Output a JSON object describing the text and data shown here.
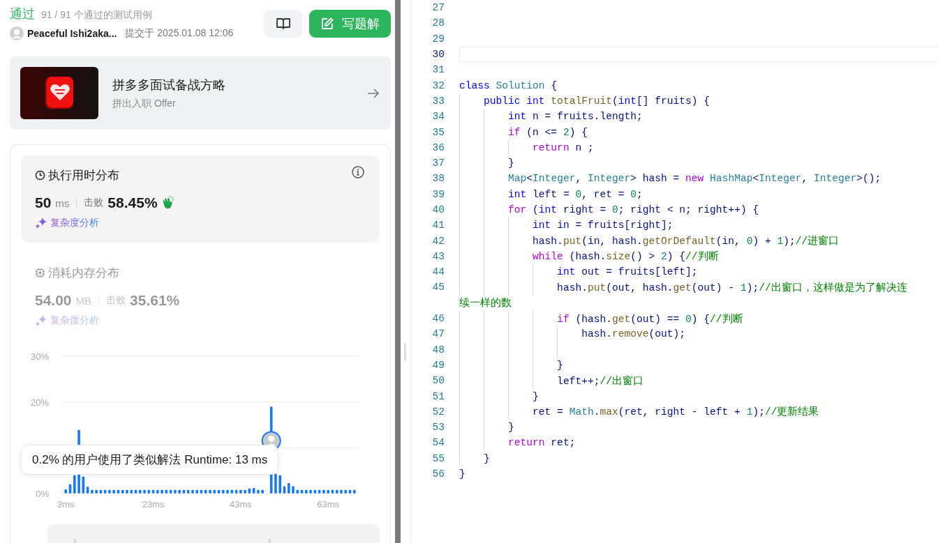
{
  "result": {
    "status": "通过",
    "cases": "91 / 91 个通过的测试用例"
  },
  "submitter": {
    "name": "Peaceful Ishi2aka...",
    "submitted": "提交于 2025.01.08 12:06"
  },
  "write_solution_button": {
    "label": "写题解"
  },
  "promo": {
    "kind": "picture",
    "title": "拼多多面试备战方略",
    "subtitle": "拼出入职 Offer"
  },
  "stats": [
    {
      "kind": "runtime",
      "title": "执行用时分布",
      "value": "50",
      "unit": "ms",
      "beats_label": "击败",
      "beats": "58.45%",
      "link": "复杂度分析",
      "selected": true
    },
    {
      "kind": "memory",
      "title": "消耗内存分布",
      "value": "54.00",
      "unit": "MB",
      "beats_label": "击败",
      "beats": "35.61%",
      "link": "复杂度分析",
      "selected": false
    }
  ],
  "distribution": {
    "tooltip": "0.2% 的用户使用了类似解法 Runtime: 13 ms",
    "chart_data": {
      "type": "bar",
      "x": [
        3,
        4,
        5,
        6,
        7,
        8,
        9,
        10,
        11,
        12,
        13,
        14,
        15,
        16,
        17,
        18,
        19,
        20,
        21,
        22,
        23,
        24,
        25,
        26,
        27,
        28,
        29,
        30,
        31,
        32,
        33,
        34,
        35,
        36,
        37,
        38,
        39,
        40,
        41,
        42,
        43,
        44,
        45,
        46,
        47,
        48,
        50,
        51,
        52,
        53,
        54,
        55,
        56,
        57,
        58,
        59,
        60,
        61,
        62,
        63,
        64,
        65,
        66,
        67,
        68,
        69
      ],
      "values": [
        0.9,
        2,
        4,
        13.9,
        3.7,
        1.5,
        0.8,
        0.8,
        0.8,
        0.8,
        0.8,
        0.8,
        0.8,
        0.8,
        0.8,
        0.8,
        0.8,
        0.8,
        0.8,
        0.8,
        0.8,
        0.8,
        0.8,
        0.8,
        0.8,
        0.8,
        0.8,
        0.8,
        0.8,
        0.8,
        0.8,
        0.8,
        0.8,
        0.8,
        0.8,
        0.8,
        0.8,
        0.8,
        0.8,
        0.8,
        0.8,
        0.8,
        1.1,
        1.2,
        0.8,
        0.8,
        19,
        4.3,
        4,
        1.6,
        2.3,
        1.6,
        0.8,
        0.8,
        0.8,
        0.8,
        0.8,
        0.8,
        0.8,
        0.8,
        0.8,
        0.8,
        0.8,
        0.8,
        0.8,
        0.8
      ],
      "xlim": [
        2,
        70
      ],
      "ylim": [
        0,
        30
      ],
      "yticks": [
        {
          "value": 0,
          "label": "0%"
        },
        {
          "value": 20,
          "label": "20%"
        },
        {
          "value": 30,
          "label": "30%"
        }
      ],
      "xticks": [
        {
          "value": 3,
          "label": "3ms"
        },
        {
          "value": 23,
          "label": "23ms"
        },
        {
          "value": 43,
          "label": "43ms"
        },
        {
          "value": 63,
          "label": "63ms"
        }
      ]
    }
  },
  "editor": {
    "lines": [
      {
        "number": "27",
        "current": false
      },
      {
        "number": "28",
        "current": false
      },
      {
        "number": "29",
        "current": false
      },
      {
        "number": "30",
        "current": true
      },
      {
        "number": "31",
        "current": false
      },
      {
        "number": "32",
        "current": false,
        "tokens": [
          {
            "kind": "kw",
            "text": "class"
          },
          {
            "kind": "type",
            "text": " Solution"
          },
          {
            "kind": "plain",
            "text": " {"
          }
        ]
      },
      {
        "number": "33",
        "current": false,
        "tokens": [
          {
            "kind": "kw",
            "text": "    public"
          },
          {
            "kind": "kw",
            "text": " int"
          },
          {
            "kind": "fn",
            "text": " totalFruit"
          },
          {
            "kind": "plain",
            "text": "("
          },
          {
            "kind": "kw",
            "text": "int"
          },
          {
            "kind": "plain",
            "text": "[] fruits) {"
          }
        ]
      },
      {
        "number": "34",
        "current": false,
        "tokens": [
          {
            "kind": "kw",
            "text": "        int"
          },
          {
            "kind": "plain",
            "text": " n = fruits.length;"
          }
        ]
      },
      {
        "number": "35",
        "current": false,
        "tokens": [
          {
            "kind": "ctrl",
            "text": "        if"
          },
          {
            "kind": "plain",
            "text": " (n <= "
          },
          {
            "kind": "num",
            "text": "2"
          },
          {
            "kind": "plain",
            "text": ") {"
          }
        ]
      },
      {
        "number": "36",
        "current": false,
        "tokens": [
          {
            "kind": "ctrl",
            "text": "            return"
          },
          {
            "kind": "plain",
            "text": " n ;"
          }
        ]
      },
      {
        "number": "37",
        "current": false,
        "tokens": [
          {
            "kind": "plain",
            "text": "        }"
          }
        ]
      },
      {
        "number": "38",
        "current": false,
        "tokens": [
          {
            "kind": "type",
            "text": "        Map"
          },
          {
            "kind": "plain",
            "text": "<"
          },
          {
            "kind": "type",
            "text": "Integer"
          },
          {
            "kind": "plain",
            "text": ", "
          },
          {
            "kind": "type",
            "text": "Integer"
          },
          {
            "kind": "plain",
            "text": "> hash = "
          },
          {
            "kind": "ctrl",
            "text": "new"
          },
          {
            "kind": "type",
            "text": " HashMap"
          },
          {
            "kind": "plain",
            "text": "<"
          },
          {
            "kind": "type",
            "text": "Integer"
          },
          {
            "kind": "plain",
            "text": ", "
          },
          {
            "kind": "type",
            "text": "Integer"
          },
          {
            "kind": "plain",
            "text": ">();"
          }
        ]
      },
      {
        "number": "39",
        "current": false,
        "tokens": [
          {
            "kind": "kw",
            "text": "        int"
          },
          {
            "kind": "plain",
            "text": " left = "
          },
          {
            "kind": "num",
            "text": "0"
          },
          {
            "kind": "plain",
            "text": ", ret = "
          },
          {
            "kind": "num",
            "text": "0"
          },
          {
            "kind": "plain",
            "text": ";"
          }
        ]
      },
      {
        "number": "40",
        "current": false,
        "tokens": [
          {
            "kind": "ctrl",
            "text": "        for"
          },
          {
            "kind": "plain",
            "text": " ("
          },
          {
            "kind": "kw",
            "text": "int"
          },
          {
            "kind": "plain",
            "text": " right = "
          },
          {
            "kind": "num",
            "text": "0"
          },
          {
            "kind": "plain",
            "text": "; right < n; right++) {"
          }
        ]
      },
      {
        "number": "41",
        "current": false,
        "tokens": [
          {
            "kind": "kw",
            "text": "            int"
          },
          {
            "kind": "plain",
            "text": " in = fruits[right];"
          }
        ]
      },
      {
        "number": "42",
        "current": false,
        "tokens": [
          {
            "kind": "plain",
            "text": "            hash."
          },
          {
            "kind": "fn",
            "text": "put"
          },
          {
            "kind": "plain",
            "text": "(in, hash."
          },
          {
            "kind": "fn",
            "text": "getOrDefault"
          },
          {
            "kind": "plain",
            "text": "(in, "
          },
          {
            "kind": "num",
            "text": "0"
          },
          {
            "kind": "plain",
            "text": ") + "
          },
          {
            "kind": "num",
            "text": "1"
          },
          {
            "kind": "plain",
            "text": ");"
          },
          {
            "kind": "cmt",
            "text": "//进窗口"
          }
        ]
      },
      {
        "number": "43",
        "current": false,
        "tokens": [
          {
            "kind": "ctrl",
            "text": "            while"
          },
          {
            "kind": "plain",
            "text": " (hash."
          },
          {
            "kind": "fn",
            "text": "size"
          },
          {
            "kind": "plain",
            "text": "() > "
          },
          {
            "kind": "num",
            "text": "2"
          },
          {
            "kind": "plain",
            "text": ") {"
          },
          {
            "kind": "cmt",
            "text": "//判断"
          }
        ]
      },
      {
        "number": "44",
        "current": false,
        "tokens": [
          {
            "kind": "kw",
            "text": "                int"
          },
          {
            "kind": "plain",
            "text": " out = fruits[left];"
          }
        ]
      },
      {
        "number": "45",
        "current": false,
        "tokens": [
          {
            "kind": "plain",
            "text": "                hash."
          },
          {
            "kind": "fn",
            "text": "put"
          },
          {
            "kind": "plain",
            "text": "(out, hash."
          },
          {
            "kind": "fn",
            "text": "get"
          },
          {
            "kind": "plain",
            "text": "(out) - "
          },
          {
            "kind": "num",
            "text": "1"
          },
          {
            "kind": "plain",
            "text": ");"
          },
          {
            "kind": "cmt",
            "text": "//出窗口，这样做是为了解决连"
          }
        ]
      },
      {
        "current": false,
        "tokens": [
          {
            "kind": "cmt",
            "text": "续一样的数"
          }
        ]
      },
      {
        "number": "46",
        "current": false,
        "tokens": [
          {
            "kind": "ctrl",
            "text": "                if"
          },
          {
            "kind": "plain",
            "text": " (hash."
          },
          {
            "kind": "fn",
            "text": "get"
          },
          {
            "kind": "plain",
            "text": "(out) == "
          },
          {
            "kind": "num",
            "text": "0"
          },
          {
            "kind": "plain",
            "text": ") {"
          },
          {
            "kind": "cmt",
            "text": "//判断"
          }
        ]
      },
      {
        "number": "47",
        "current": false,
        "tokens": [
          {
            "kind": "plain",
            "text": "                    hash."
          },
          {
            "kind": "fn",
            "text": "remove"
          },
          {
            "kind": "plain",
            "text": "(out);"
          }
        ]
      },
      {
        "number": "48",
        "current": false
      },
      {
        "number": "49",
        "current": false,
        "tokens": [
          {
            "kind": "plain",
            "text": "                }"
          }
        ]
      },
      {
        "number": "50",
        "current": false,
        "tokens": [
          {
            "kind": "plain",
            "text": "                left++;"
          },
          {
            "kind": "cmt",
            "text": "//出窗口"
          }
        ]
      },
      {
        "number": "51",
        "current": false,
        "tokens": [
          {
            "kind": "plain",
            "text": "            }"
          }
        ]
      },
      {
        "number": "52",
        "current": false,
        "tokens": [
          {
            "kind": "plain",
            "text": "            ret = "
          },
          {
            "kind": "type",
            "text": "Math"
          },
          {
            "kind": "plain",
            "text": "."
          },
          {
            "kind": "fn",
            "text": "max"
          },
          {
            "kind": "plain",
            "text": "(ret, right - left + "
          },
          {
            "kind": "num",
            "text": "1"
          },
          {
            "kind": "plain",
            "text": ");"
          },
          {
            "kind": "cmt",
            "text": "//更新结果"
          }
        ]
      },
      {
        "number": "53",
        "current": false,
        "tokens": [
          {
            "kind": "plain",
            "text": "        }"
          }
        ]
      },
      {
        "number": "54",
        "current": false,
        "tokens": [
          {
            "kind": "ctrl",
            "text": "        return"
          },
          {
            "kind": "plain",
            "text": " ret;"
          }
        ]
      },
      {
        "number": "55",
        "current": false,
        "tokens": [
          {
            "kind": "plain",
            "text": "    }"
          }
        ]
      },
      {
        "number": "56",
        "current": false,
        "tokens": [
          {
            "kind": "plain",
            "text": "}"
          }
        ]
      }
    ]
  }
}
